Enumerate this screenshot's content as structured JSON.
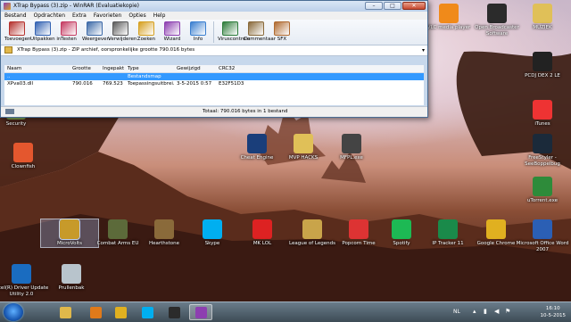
{
  "window": {
    "title": "XTrap Bypass (3).zip - WinRAR (Evaluatiekopie)",
    "controls": [
      "–",
      "□",
      "✕"
    ]
  },
  "menu": [
    "Bestand",
    "Opdrachten",
    "Extra",
    "Favorieten",
    "Opties",
    "Help"
  ],
  "toolbar": [
    {
      "label": "Toevoegen",
      "icon": "add-icon",
      "color": "#b5322e"
    },
    {
      "label": "Uitpakken in",
      "icon": "extract-icon",
      "color": "#3463b3"
    },
    {
      "label": "Testen",
      "icon": "test-icon",
      "color": "#c53b62"
    },
    {
      "label": "Weergeven",
      "icon": "view-icon",
      "color": "#3d6aa8"
    },
    {
      "label": "Verwijderen",
      "icon": "delete-icon",
      "color": "#5b5b5b"
    },
    {
      "label": "Zoeken",
      "icon": "find-icon",
      "color": "#d6a020"
    },
    {
      "label": "Wizard",
      "icon": "wizard-icon",
      "color": "#8d3fb0"
    },
    {
      "label": "Info",
      "icon": "info-icon",
      "color": "#3a7fd0"
    },
    {
      "label": "Viruscontrole",
      "icon": "virusscan-icon",
      "color": "#2e7d3b"
    },
    {
      "label": "Commentaar",
      "icon": "comment-icon",
      "color": "#8a6a3a"
    },
    {
      "label": "SFX",
      "icon": "sfx-icon",
      "color": "#b06a30"
    }
  ],
  "address": "XTrap Bypass (3).zip - ZIP archief, oorspronkelijke grootte 790.016 bytes",
  "list": {
    "headers": [
      "Naam",
      "Grootte",
      "Ingepakt",
      "Type",
      "Gewijzigd",
      "CRC32"
    ],
    "rows": [
      [
        "..",
        "",
        "",
        "Bestandsmap",
        "",
        ""
      ],
      [
        "XPva03.dll",
        "790.016",
        "769.523",
        "Toepassingsuitbrei...",
        "3-5-2015 0:57",
        "E32F51D3"
      ]
    ]
  },
  "status": "Totaal: 790.016 bytes in 1 bestand",
  "desktop_icons": [
    {
      "label": "VLC media player",
      "icon": "vlc-icon",
      "color": "#f08a1a"
    },
    {
      "label": "Open Broadcaster Software",
      "icon": "obs-icon",
      "color": "#2b2b2b"
    },
    {
      "label": "MUZIEK",
      "icon": "folder-icon",
      "color": "#e0c058"
    },
    {
      "label": "PCDJ DEX 2 LE",
      "icon": "pcdj-icon",
      "color": "#222"
    },
    {
      "label": "iTunes",
      "icon": "itunes-icon",
      "color": "#e33"
    },
    {
      "label": "Security",
      "icon": "security-icon",
      "color": "#8a5"
    },
    {
      "label": "Clownfish",
      "icon": "clownfish-icon",
      "color": "#e4572e"
    },
    {
      "label": "Cheat Engine",
      "icon": "cheat-engine-icon",
      "color": "#1a3e7a"
    },
    {
      "label": "MVP HACKS",
      "icon": "folder-icon",
      "color": "#e0c058"
    },
    {
      "label": "MFPL.exe",
      "icon": "skull-icon",
      "color": "#444"
    },
    {
      "label": "FreeStyler - SeeBoppelbug",
      "icon": "fc3-icon",
      "color": "#1b2a3a"
    },
    {
      "label": "uTorrent.exe",
      "icon": "utorrent-icon",
      "color": "#2e8b3a"
    },
    {
      "label": "MicroVolts",
      "icon": "microvolts-icon",
      "color": "#c79a2a"
    },
    {
      "label": "Combat Arms EU",
      "icon": "combat-arms-icon",
      "color": "#5c6a3a"
    },
    {
      "label": "Hearthstone",
      "icon": "hearthstone-icon",
      "color": "#8a6a3a"
    },
    {
      "label": "Skype",
      "icon": "skype-icon",
      "color": "#00aff0"
    },
    {
      "label": "MK LOL",
      "icon": "mklol-icon",
      "color": "#d22"
    },
    {
      "label": "League of Legends",
      "icon": "lol-icon",
      "color": "#c9a44a"
    },
    {
      "label": "Popcorn Time",
      "icon": "popcorn-icon",
      "color": "#d33"
    },
    {
      "label": "Spotify",
      "icon": "spotify-icon",
      "color": "#1db954"
    },
    {
      "label": "IP Tracker 11",
      "icon": "ip-tracker-icon",
      "color": "#1a8a4a"
    },
    {
      "label": "Google Chrome",
      "icon": "chrome-icon",
      "color": "#e0b020"
    },
    {
      "label": "Microsoft Office Word 2007",
      "icon": "word-icon",
      "color": "#2b5fb4"
    },
    {
      "label": "Intel(R) Driver Update Utility 2.0",
      "icon": "intel-icon",
      "color": "#1a6cc0"
    },
    {
      "label": "Prullenbak",
      "icon": "recycle-bin-icon",
      "color": "#b8c4cc"
    }
  ],
  "taskbar": {
    "apps": [
      {
        "name": "explorer",
        "icon": "explorer-icon",
        "color": "#e0b84b"
      },
      {
        "name": "media",
        "icon": "media-player-icon",
        "color": "#e07a1a"
      },
      {
        "name": "chrome",
        "icon": "chrome-icon",
        "color": "#e0b020"
      },
      {
        "name": "skype",
        "icon": "skype-icon",
        "color": "#00aff0"
      },
      {
        "name": "obs",
        "icon": "obs-icon",
        "color": "#2b2b2b"
      },
      {
        "name": "winrar",
        "icon": "winrar-icon",
        "color": "#8d3fb0"
      }
    ],
    "lang": "NL",
    "time": "16:10",
    "date": "10-5-2015"
  }
}
